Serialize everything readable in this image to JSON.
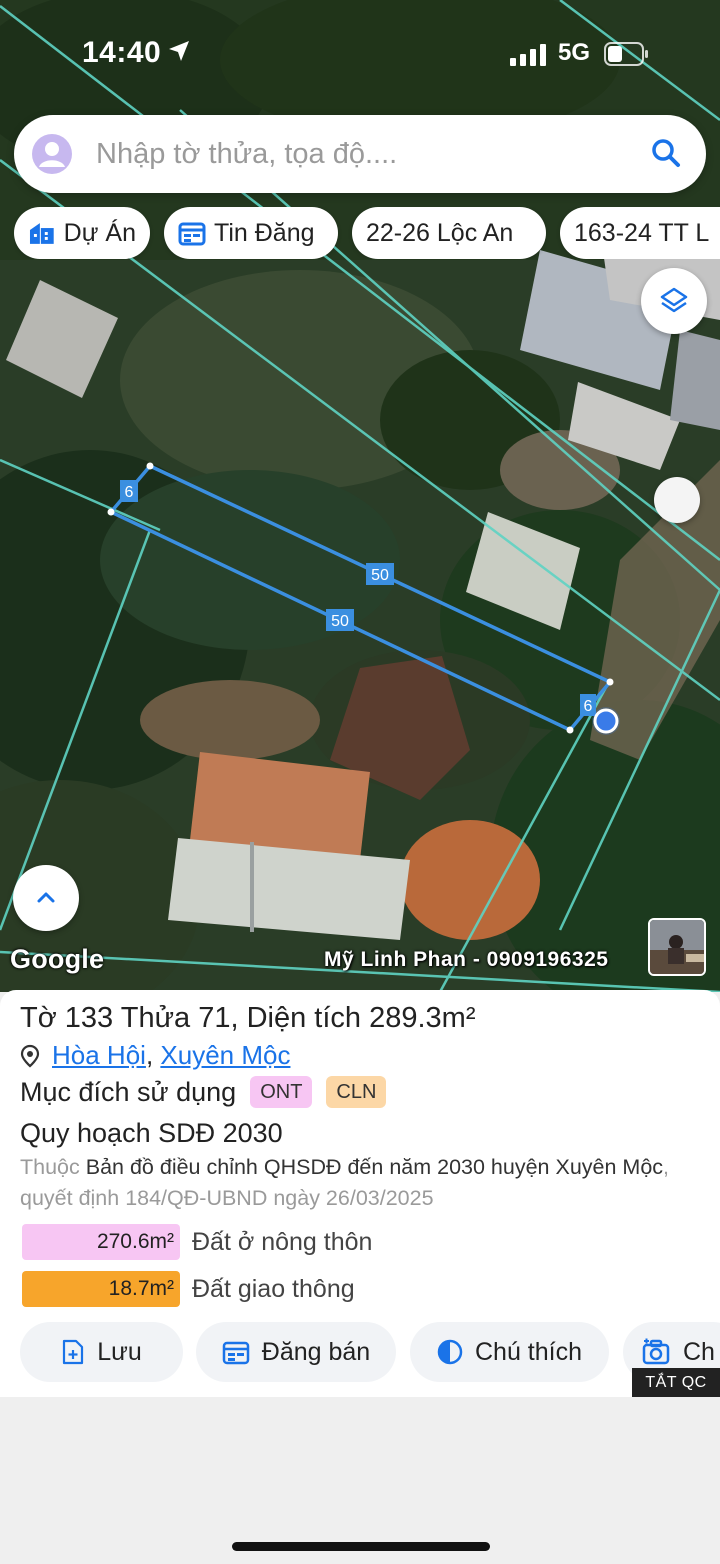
{
  "status_bar": {
    "time": "14:40",
    "network": "5G"
  },
  "search": {
    "placeholder": "Nhập tờ thửa, tọa độ...."
  },
  "chips": [
    {
      "label": "Dự Án",
      "icon": "building-icon"
    },
    {
      "label": "Tin Đăng",
      "icon": "calendar-icon"
    },
    {
      "label": "22-26 Lộc An"
    },
    {
      "label": "163-24 TT L"
    }
  ],
  "map": {
    "provider_label": "Google",
    "watermark": "Mỹ Linh Phan - 0909196325",
    "edge_labels": {
      "left": "6",
      "top": "50",
      "bottom": "50",
      "right": "6"
    },
    "colors": {
      "parcel_line": "#3b8fe0",
      "boundary_line": "#5fd3c3",
      "location_dot": "#3a7be8"
    }
  },
  "parcel": {
    "title_prefix": "Tờ",
    "sheet": "133",
    "plot_label": "Thửa",
    "plot": "71",
    "area_label": "Diện tích",
    "area": "289.3m²",
    "commune": "Hòa Hội",
    "district": "Xuyên Mộc",
    "usage_label": "Mục đích sử dụng",
    "usage_codes": [
      {
        "code": "ONT",
        "color": "#f7c6f3"
      },
      {
        "code": "CLN",
        "color": "#fcd7a6"
      }
    ],
    "planning_title": "Quy hoạch SDĐ 2030",
    "ref_prefix": "Thuộc",
    "ref_map": "Bản đồ điều chỉnh QHSDĐ đến năm 2030 huyện Xuyên Mộc",
    "ref_suffix": ", quyết định 184/QĐ-UBND ngày 26/03/2025",
    "land_use": [
      {
        "area": "270.6m²",
        "label": "Đất ở nông thôn",
        "color": "#f7c6f3"
      },
      {
        "area": "18.7m²",
        "label": "Đất giao thông",
        "color": "#f7a52b"
      }
    ]
  },
  "actions": [
    {
      "label": "Lưu",
      "icon": "save-plus-icon"
    },
    {
      "label": "Đăng bán",
      "icon": "calendar-icon"
    },
    {
      "label": "Chú thích",
      "icon": "half-circle-icon"
    },
    {
      "label": "Ch",
      "icon": "camera-icon"
    }
  ],
  "ad_toggle": "TẮT QC"
}
